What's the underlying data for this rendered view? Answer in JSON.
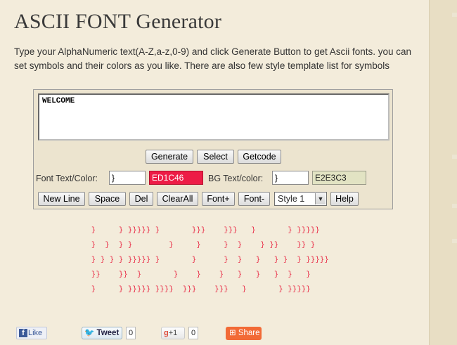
{
  "header": {
    "title": "ASCII FONT Generator"
  },
  "intro": "Type your AlphaNumeric text(A-Z,a-z,0-9) and click Generate Button to get Ascii fonts. you can set symbols and their colors as you like. There are also few style template list for symbols",
  "editor": {
    "text": "WELCOME"
  },
  "actions": {
    "generate": "Generate",
    "select": "Select",
    "getcode": "Getcode"
  },
  "font_text": {
    "label": "Font Text/Color:",
    "symbol": "}",
    "color": "ED1C46"
  },
  "bg_text": {
    "label": "BG Text/color:",
    "symbol": "}",
    "color": "E2E3C3"
  },
  "toolbar": {
    "new_line": "New Line",
    "space": "Space",
    "del": "Del",
    "clear_all": "ClearAll",
    "font_plus": "Font+",
    "font_minus": "Font-",
    "style_value": "Style 1",
    "help": "Help"
  },
  "output": {
    "lines": [
      "}     } }}}}} }       }}}    }}}   }       } }}}}}",
      "}  }  } }        }     }     }  }    } }}    }} }",
      "} } } } }}}}} }       }      }  }   }   } }  } }}}}}",
      "}}    }}  }       }    }    }   }   }   }  }   }",
      "}     } }}}}} }}}}  }}}    }}}   }       } }}}}}"
    ],
    "color": "#e8203d"
  },
  "social": {
    "like": "Like",
    "tweet": "Tweet",
    "tweet_count": "0",
    "gplus": "+1",
    "gplus_count": "0",
    "share": "Share"
  },
  "colors": {
    "accent": "#ED1C46",
    "bg": "#E2E3C3"
  }
}
